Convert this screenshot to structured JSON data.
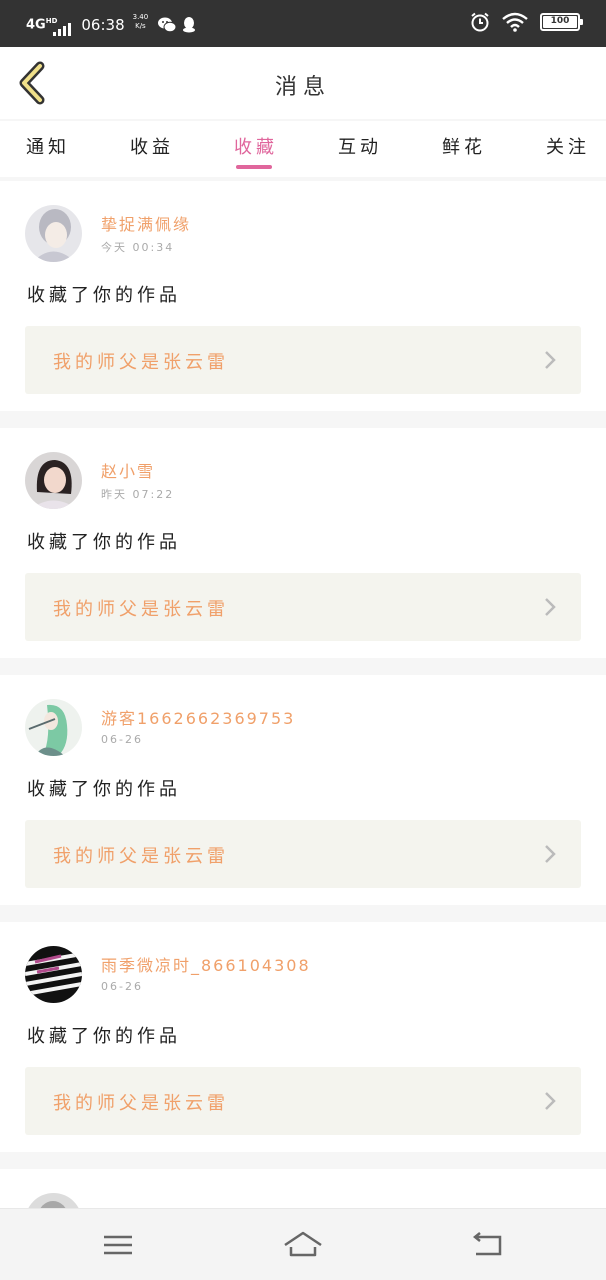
{
  "status_bar": {
    "network": "4G",
    "network_sup": "HD",
    "time": "06:38",
    "speed_value": "3.40",
    "speed_unit": "K/s",
    "battery": "100",
    "battery_level": 1.0
  },
  "header": {
    "title": "消息",
    "back_icon": "chevron-left-icon"
  },
  "tabs": [
    {
      "label": "通知",
      "active": false
    },
    {
      "label": "收益",
      "active": false
    },
    {
      "label": "收藏",
      "active": true
    },
    {
      "label": "互动",
      "active": false
    },
    {
      "label": "鲜花",
      "active": false
    },
    {
      "label": "关注",
      "active": false
    }
  ],
  "notifications": [
    {
      "user": "挚捉满佩缘",
      "time": "今天 00:34",
      "message": "收藏了你的作品",
      "work_title": "我的师父是张云雷"
    },
    {
      "user": "赵小雪",
      "time": "昨天 07:22",
      "message": "收藏了你的作品",
      "work_title": "我的师父是张云雷"
    },
    {
      "user": "游客1662662369753",
      "time": "06-26",
      "message": "收藏了你的作品",
      "work_title": "我的师父是张云雷"
    },
    {
      "user": "雨季微凉时_866104308",
      "time": "06-26",
      "message": "收藏了你的作品",
      "work_title": "我的师父是张云雷"
    }
  ],
  "colors": {
    "accent": "#e0669c",
    "username": "#f0a06a",
    "status_bar": "#333333"
  },
  "navbar": {
    "icons": [
      "menu-icon",
      "home-icon",
      "back-icon"
    ]
  }
}
